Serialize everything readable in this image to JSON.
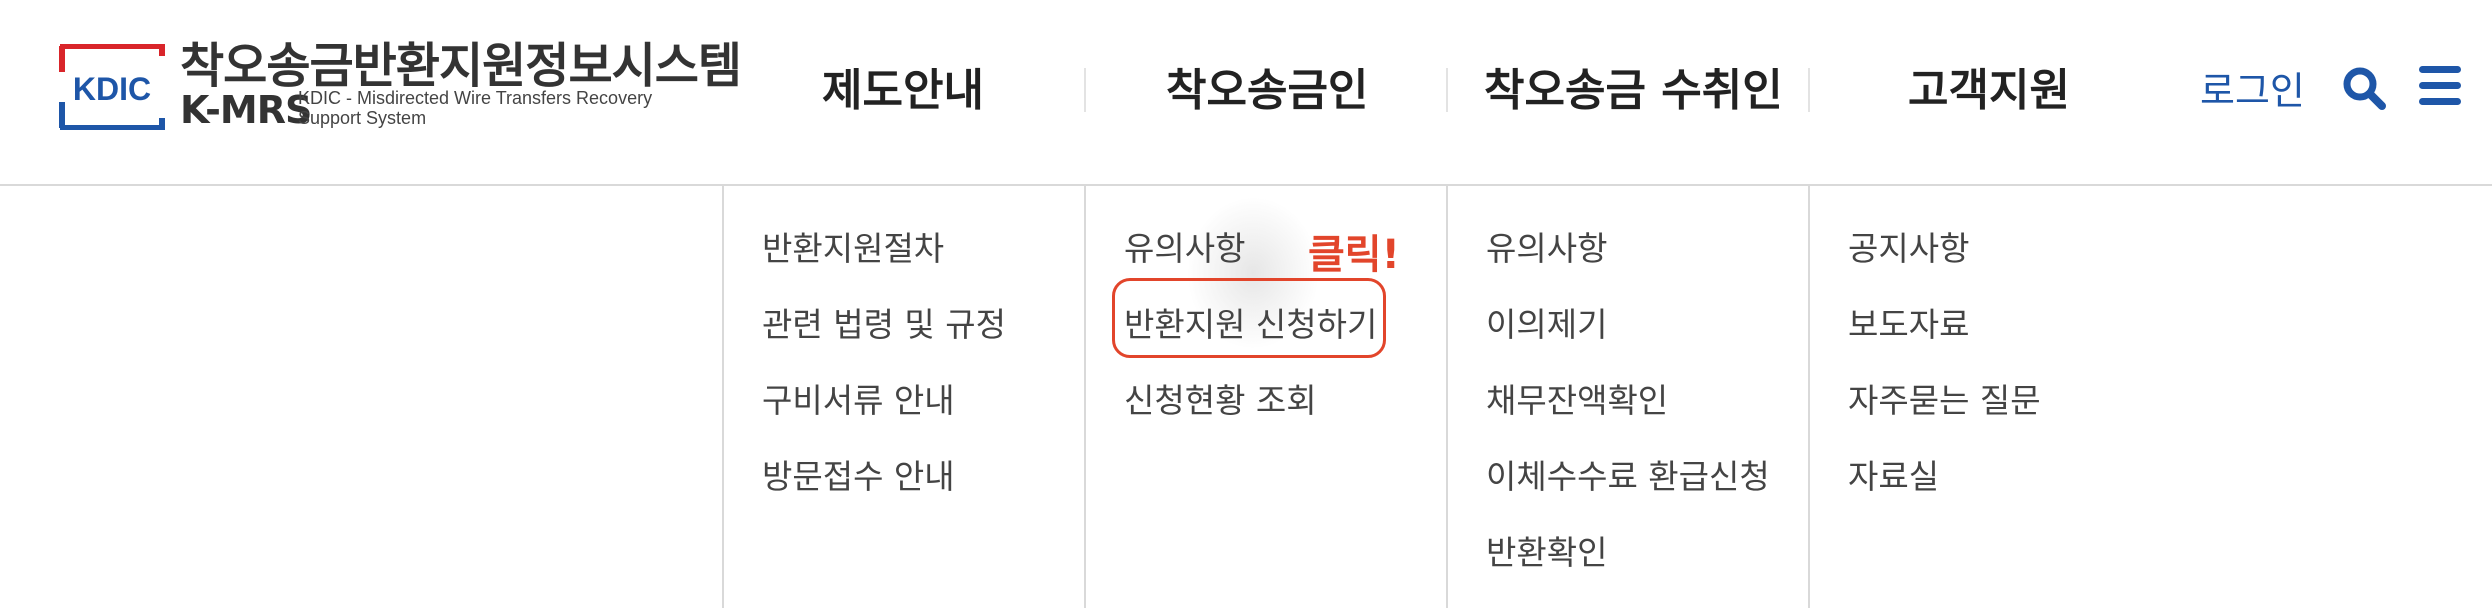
{
  "logo": {
    "badge": "KDIC",
    "title": "착오송금반환지원정보시스템",
    "abbr": "K-MRS",
    "subtitle_line1": "KDIC - Misdirected Wire Transfers Recovery",
    "subtitle_line2": "Support System"
  },
  "nav": {
    "items": [
      {
        "label": "제도안내"
      },
      {
        "label": "착오송금인"
      },
      {
        "label": "착오송금 수취인"
      },
      {
        "label": "고객지원"
      }
    ],
    "login_label": "로그인"
  },
  "submenu": {
    "columns": [
      {
        "items": [
          "반환지원절차",
          "관련 법령 및 규정",
          "구비서류 안내",
          "방문접수 안내"
        ]
      },
      {
        "items": [
          "유의사항",
          "반환지원 신청하기",
          "신청현황 조회"
        ]
      },
      {
        "items": [
          "유의사항",
          "이의제기",
          "채무잔액확인",
          "이체수수료 환급신청",
          "반환확인"
        ]
      },
      {
        "items": [
          "공지사항",
          "보도자료",
          "자주묻는 질문",
          "자료실"
        ]
      }
    ]
  },
  "annotation": {
    "click_label": "클릭!"
  },
  "colors": {
    "brand_blue": "#1e56a8",
    "logo_red": "#d9252a",
    "highlight": "#e2452b"
  },
  "icons": [
    "search-icon",
    "hamburger-menu-icon"
  ]
}
